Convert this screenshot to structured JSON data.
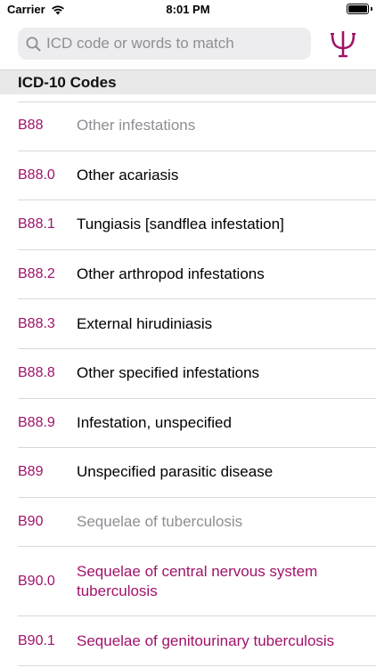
{
  "status_bar": {
    "carrier": "Carrier",
    "time": "8:01 PM"
  },
  "search": {
    "placeholder": "ICD code or words to match",
    "value": ""
  },
  "section": {
    "title": "ICD-10 Codes"
  },
  "colors": {
    "accent": "#a0136a",
    "secondary_text": "#8e8e93",
    "section_bg": "#e9e9ea",
    "search_bg": "#ededf0"
  },
  "rows": [
    {
      "code": "B88",
      "desc": "Other infestations",
      "style": "gray"
    },
    {
      "code": "B88.0",
      "desc": "Other acariasis",
      "style": "black"
    },
    {
      "code": "B88.1",
      "desc": "Tungiasis [sandflea infestation]",
      "style": "black"
    },
    {
      "code": "B88.2",
      "desc": "Other arthropod infestations",
      "style": "black"
    },
    {
      "code": "B88.3",
      "desc": "External hirudiniasis",
      "style": "black"
    },
    {
      "code": "B88.8",
      "desc": "Other specified infestations",
      "style": "black"
    },
    {
      "code": "B88.9",
      "desc": "Infestation, unspecified",
      "style": "black"
    },
    {
      "code": "B89",
      "desc": "Unspecified parasitic disease",
      "style": "black"
    },
    {
      "code": "B90",
      "desc": "Sequelae of tuberculosis",
      "style": "gray"
    },
    {
      "code": "B90.0",
      "desc": "Sequelae of central nervous system tuberculosis",
      "style": "magenta"
    },
    {
      "code": "B90.1",
      "desc": "Sequelae of genitourinary tuberculosis",
      "style": "magenta"
    }
  ]
}
